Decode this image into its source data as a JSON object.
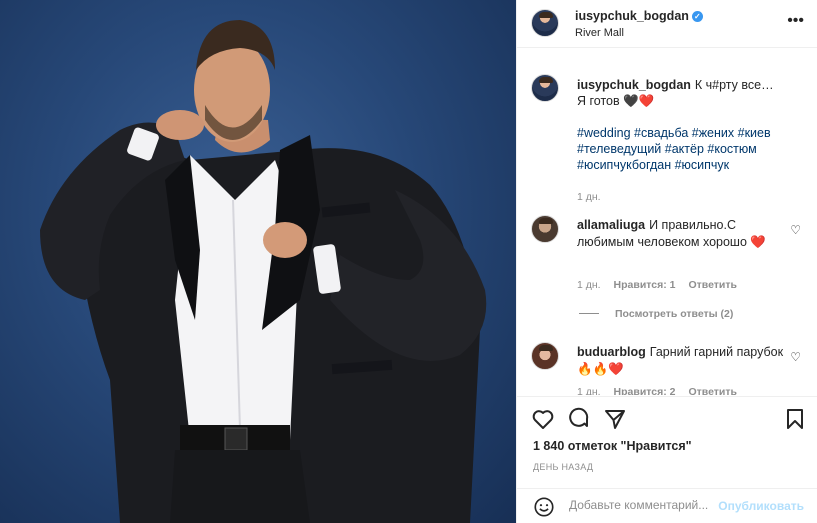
{
  "post": {
    "username": "iusypchuk_bogdan",
    "verified_mark": "✓",
    "location": "River Mall",
    "more_icon": "more-horizontal-icon"
  },
  "caption": {
    "username": "iusypchuk_bogdan",
    "text_line1": "К ч#рту все…",
    "text_line2": "Я готов 🖤❤️",
    "hashtags": "#wedding #свадьба #жених #киев #телеведущий #актёр #костюм #юсипчукбогдан #юсипчук",
    "age": "1 дн."
  },
  "comments": [
    {
      "username": "allamaliuga",
      "text": "И правильно.С любимым человеком хорошо ❤️",
      "age": "1 дн.",
      "likes": "Нравится: 1",
      "reply": "Ответить"
    },
    {
      "username": "buduarblog",
      "text": "Гарний гарний парубок 🔥🔥❤️",
      "age": "1 дн.",
      "likes": "Нравится: 2",
      "reply": "Ответить"
    }
  ],
  "view_replies": "Посмотреть ответы (2)",
  "likes_count": "1 840 отметок \"Нравится\"",
  "time_ago": "ДЕНЬ НАЗАД",
  "comment_box": {
    "placeholder": "Добавьте комментарий...",
    "publish_label": "Опубликовать"
  },
  "colors": {
    "photo_background": "#274878",
    "link": "#00376b",
    "verified": "#3897f0",
    "publish_disabled": "#b2dffc"
  }
}
